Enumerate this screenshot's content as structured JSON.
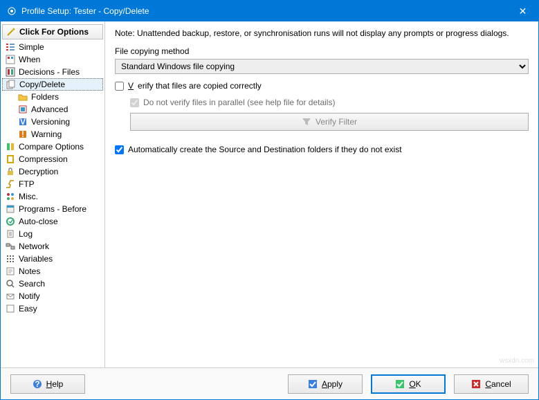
{
  "title": "Profile Setup: Tester - Copy/Delete",
  "sidebar": {
    "header": "Click For Options",
    "items": [
      {
        "label": "Simple"
      },
      {
        "label": "When"
      },
      {
        "label": "Decisions - Files"
      },
      {
        "label": "Copy/Delete",
        "selected": true
      },
      {
        "label": "Compare Options"
      },
      {
        "label": "Compression"
      },
      {
        "label": "Decryption"
      },
      {
        "label": "FTP"
      },
      {
        "label": "Misc."
      },
      {
        "label": "Programs - Before"
      },
      {
        "label": "Auto-close"
      },
      {
        "label": "Log"
      },
      {
        "label": "Network"
      },
      {
        "label": "Variables"
      },
      {
        "label": "Notes"
      },
      {
        "label": "Search"
      },
      {
        "label": "Notify"
      },
      {
        "label": "Easy"
      }
    ],
    "children": [
      {
        "label": "Folders"
      },
      {
        "label": "Advanced"
      },
      {
        "label": "Versioning"
      },
      {
        "label": "Warning"
      }
    ]
  },
  "content": {
    "note": "Note: Unattended backup, restore, or synchronisation runs will not display any prompts or progress dialogs.",
    "method_label": "File copying method",
    "method_value": "Standard Windows file copying",
    "verify_label": "Verify that files are copied correctly",
    "noparallel_label": "Do not verify files in parallel (see help file for details)",
    "verify_filter_btn": "Verify Filter",
    "autocreate_label": "Automatically create the Source and Destination folders if they do not exist"
  },
  "footer": {
    "help": "Help",
    "apply": "Apply",
    "ok": "OK",
    "cancel": "Cancel"
  },
  "watermark": "wsxdn.com"
}
